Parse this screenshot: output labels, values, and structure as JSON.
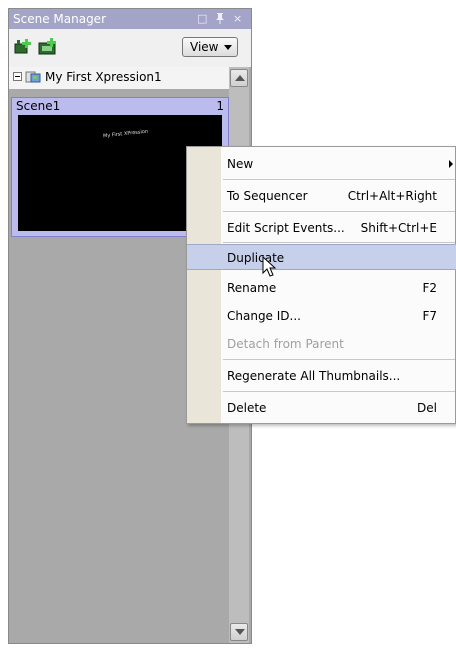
{
  "panel": {
    "title": "Scene Manager",
    "title_buttons": [
      "□",
      "📌",
      "×"
    ],
    "toolbar": {
      "icons": [
        "add-scene-icon",
        "add-scene-group-icon"
      ],
      "view_label": "View"
    },
    "tree": {
      "project_name": "My First Xpression1"
    },
    "scene": {
      "name": "Scene1",
      "number": "1",
      "thumbnail_text": "My First XPression"
    }
  },
  "menu": {
    "items": [
      {
        "label": "New",
        "shortcut": "",
        "submenu": true
      },
      {
        "label": "To Sequencer",
        "shortcut": "Ctrl+Alt+Right"
      },
      {
        "label": "Edit Script Events...",
        "shortcut": "Shift+Ctrl+E"
      },
      {
        "label": "Duplicate",
        "shortcut": "",
        "highlighted": true
      },
      {
        "label": "Rename",
        "shortcut": "F2"
      },
      {
        "label": "Change ID...",
        "shortcut": "F7"
      },
      {
        "label": "Detach from Parent",
        "shortcut": "",
        "disabled": true
      },
      {
        "label": "Regenerate All Thumbnails...",
        "shortcut": ""
      },
      {
        "label": "Delete",
        "shortcut": "Del"
      }
    ]
  },
  "colors": {
    "titlebar": "#a4a4c8",
    "highlight": "#c6d0ea",
    "scene_card": "#bbbbee",
    "menu_gutter": "#e9e5d8"
  }
}
